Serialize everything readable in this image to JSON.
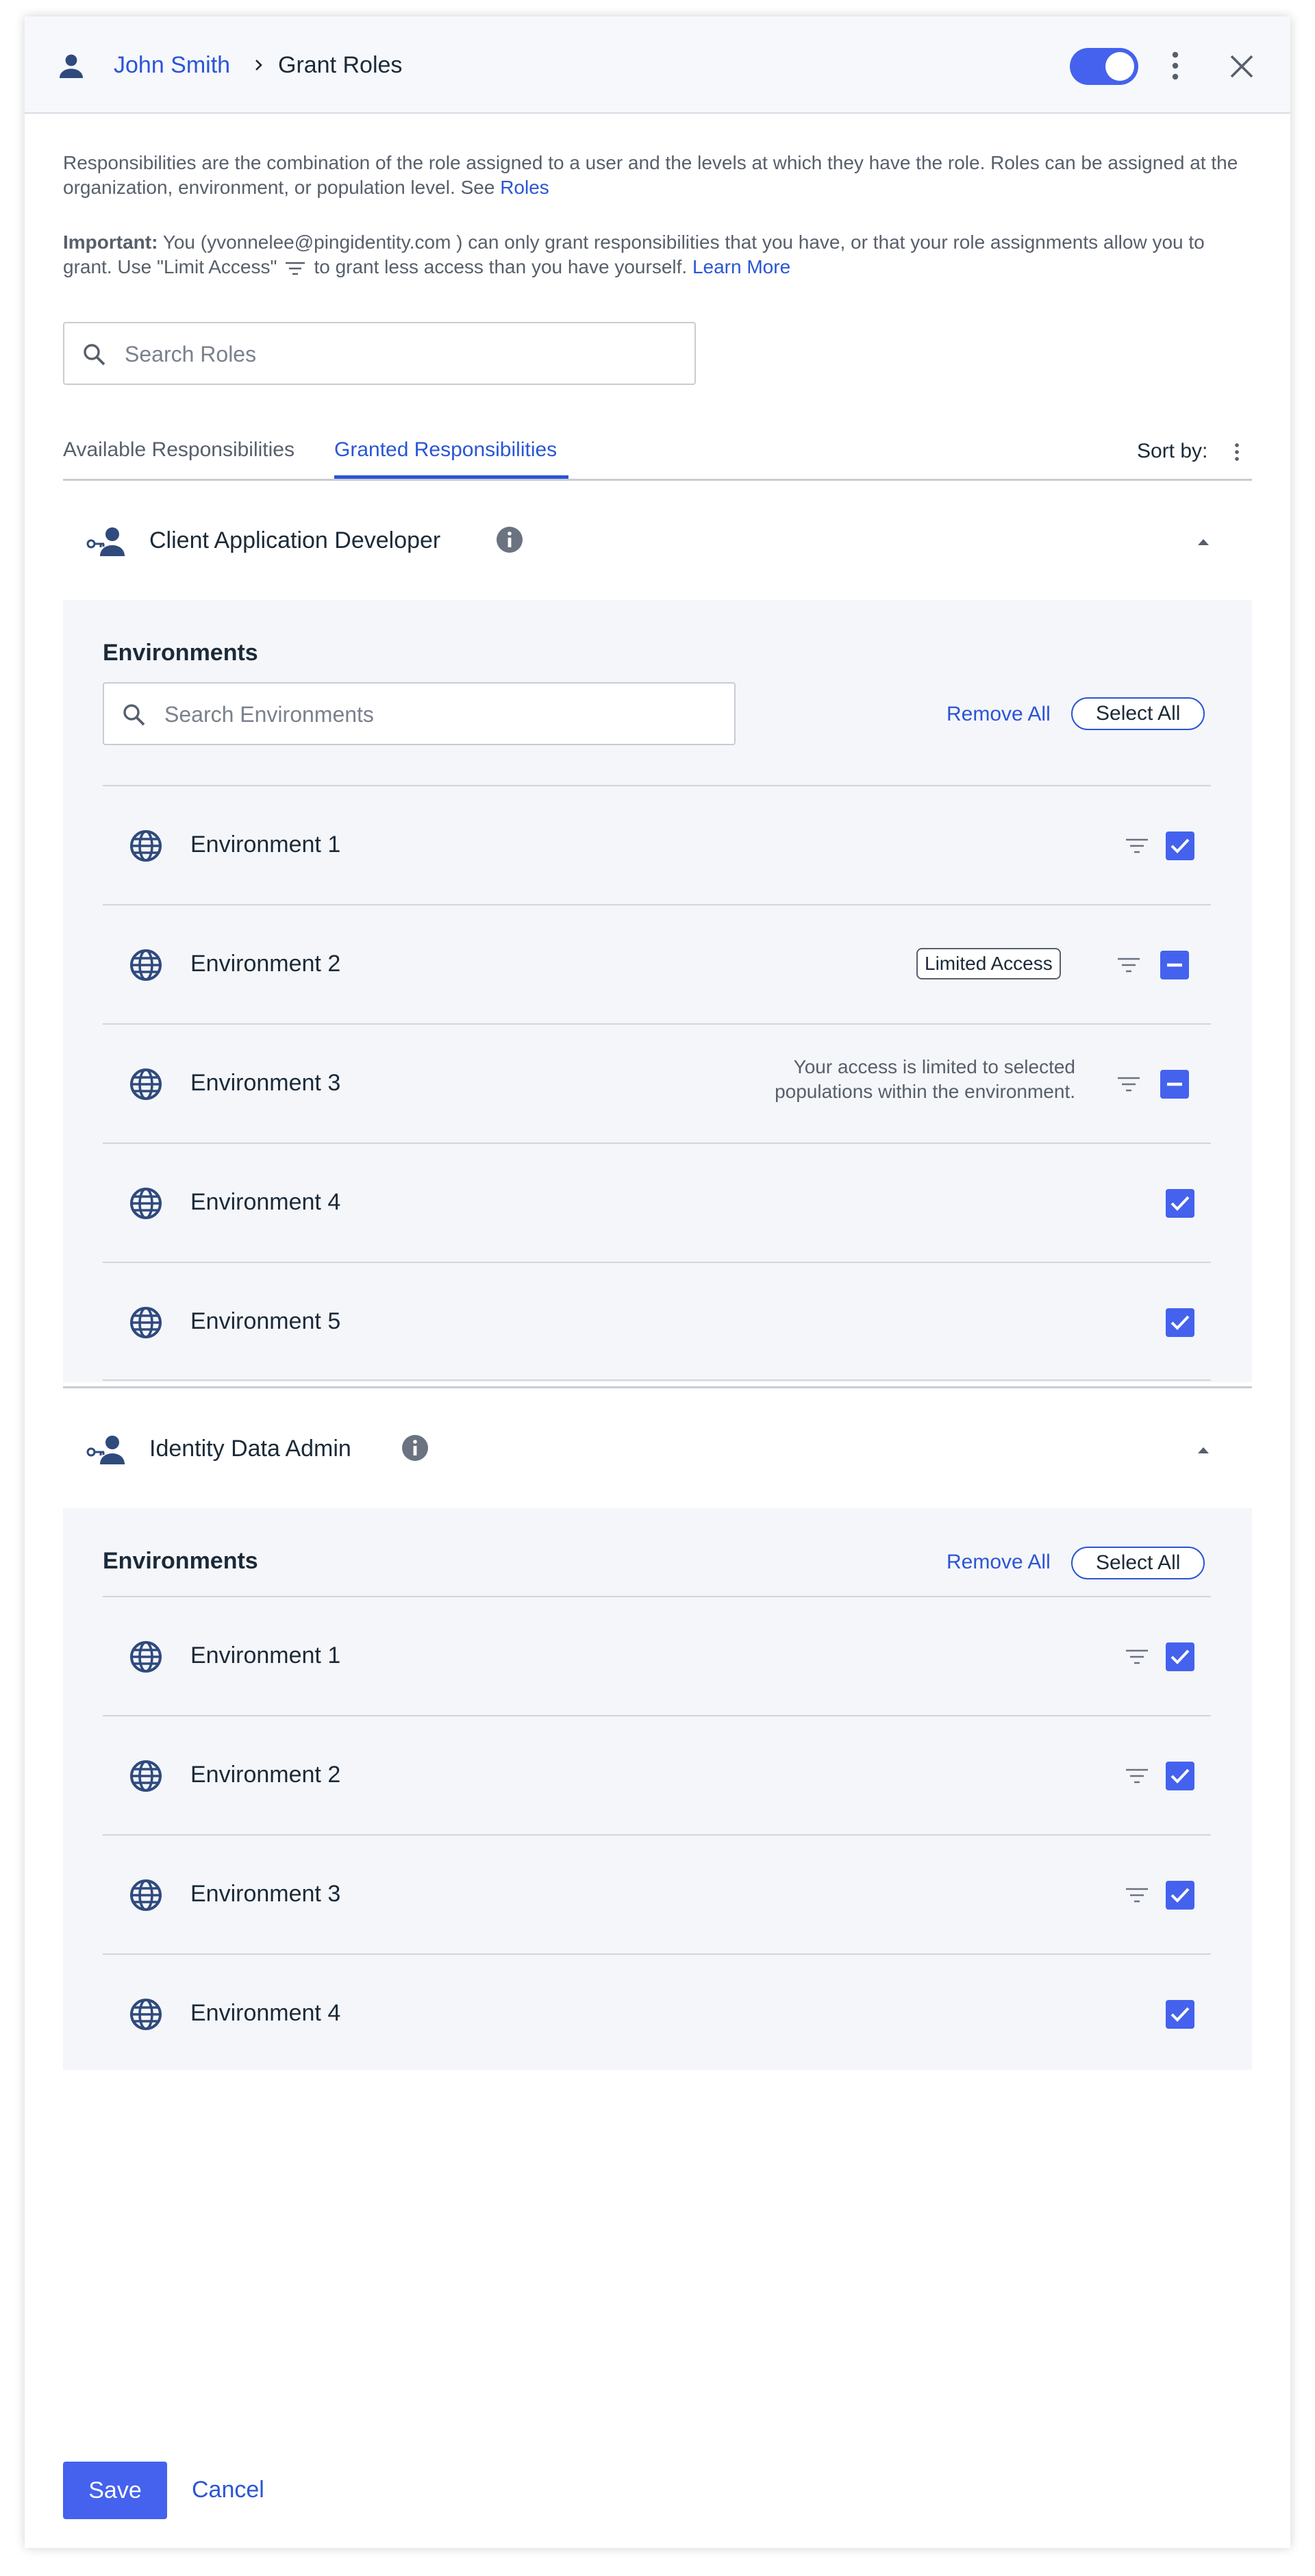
{
  "header": {
    "user_name": "John Smith",
    "title": "Grant Roles",
    "toggle_on": true,
    "icons": [
      "user-icon",
      "chevron-right-icon",
      "kebab-icon",
      "close-icon"
    ]
  },
  "intro": {
    "text": "Responsibilities are the combination of the role assigned to a user and the levels at which they have the role. Roles can be assigned at the organization, environment, or population level. See ",
    "link": "Roles"
  },
  "important": {
    "label": "Important:",
    "text_before": " You (yvonnelee@pingidentity.com ) can only grant responsibilities that you have, or that your role assignments allow you to grant. Use \"Limit Access\"",
    "text_after": "to grant less access than you have yourself.",
    "link": "Learn More"
  },
  "search_roles": {
    "placeholder": "Search Roles"
  },
  "tabs": {
    "available": "Available Responsibilities",
    "granted": "Granted Responsibilities",
    "active": "granted",
    "sort_label": "Sort by:"
  },
  "roles": [
    {
      "name": "Client Application Developer",
      "section_title": "Environments",
      "search_placeholder": "Search Environments",
      "remove_all": "Remove All",
      "select_all": "Select All",
      "environments": [
        {
          "name": "Environment 1",
          "state": "checked",
          "filter": true
        },
        {
          "name": "Environment 2",
          "state": "indeterminate",
          "filter": true,
          "badge": "Limited Access"
        },
        {
          "name": "Environment 3",
          "state": "indeterminate",
          "filter": true,
          "note_line1": "Your access is limited to selected",
          "note_line2": "populations within the environment."
        },
        {
          "name": "Environment 4",
          "state": "checked",
          "filter": false
        },
        {
          "name": "Environment 5",
          "state": "checked",
          "filter": false
        }
      ]
    },
    {
      "name": "Identity Data Admin",
      "section_title": "Environments",
      "remove_all": "Remove All",
      "select_all": "Select All",
      "environments": [
        {
          "name": "Environment 1",
          "state": "checked",
          "filter": true
        },
        {
          "name": "Environment 2",
          "state": "checked",
          "filter": true
        },
        {
          "name": "Environment 3",
          "state": "checked",
          "filter": true
        },
        {
          "name": "Environment 4",
          "state": "checked",
          "filter": false
        }
      ]
    }
  ],
  "footer": {
    "save": "Save",
    "cancel": "Cancel"
  },
  "colors": {
    "accent": "#2a55d6",
    "checkbox": "#4462ed",
    "panel_bg": "#f5f6fa"
  }
}
